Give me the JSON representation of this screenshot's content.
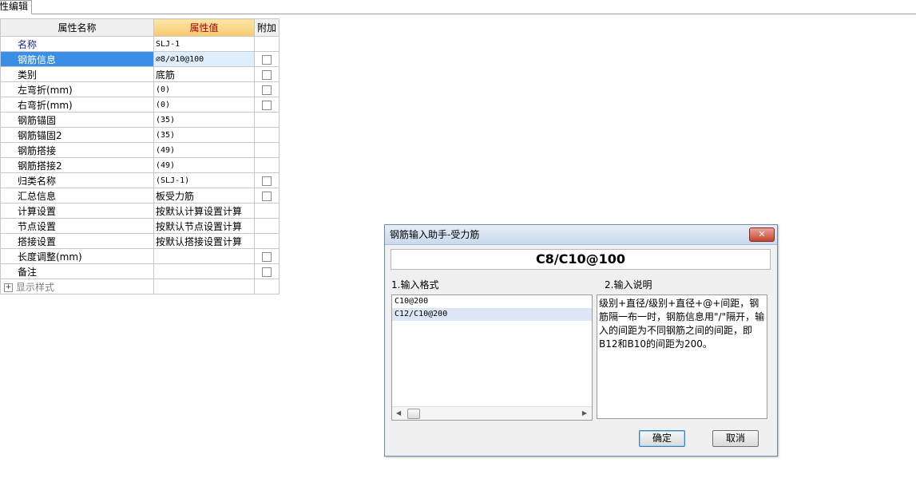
{
  "tab": {
    "label": "性编辑"
  },
  "grid": {
    "headers": {
      "name": "属性名称",
      "value": "属性值",
      "extra": "附加"
    },
    "rows": [
      {
        "name": "名称",
        "value": "SLJ-1"
      },
      {
        "name": "钢筋信息",
        "value": "⌀8/⌀10@100",
        "selected": true
      },
      {
        "name": "类别",
        "value": "底筋"
      },
      {
        "name": "左弯折(mm)",
        "value": "(0)"
      },
      {
        "name": "右弯折(mm)",
        "value": "(0)"
      },
      {
        "name": "钢筋锚固",
        "value": "(35)"
      },
      {
        "name": "钢筋锚固2",
        "value": "(35)"
      },
      {
        "name": "钢筋搭接",
        "value": "(49)"
      },
      {
        "name": "钢筋搭接2",
        "value": "(49)"
      },
      {
        "name": "归类名称",
        "value": "(SLJ-1)"
      },
      {
        "name": "汇总信息",
        "value": "板受力筋"
      },
      {
        "name": "计算设置",
        "value": "按默认计算设置计算"
      },
      {
        "name": "节点设置",
        "value": "按默认节点设置计算"
      },
      {
        "name": "搭接设置",
        "value": "按默认搭接设置计算"
      },
      {
        "name": "长度调整(mm)",
        "value": ""
      },
      {
        "name": "备注",
        "value": ""
      }
    ],
    "expand_row": "显示样式"
  },
  "dialog": {
    "title": "钢筋输入助手-受力筋",
    "close_label": "✕",
    "display_value": "C8/C10@100",
    "format_label": "1.输入格式",
    "desc_label": "2.输入说明",
    "formats": [
      "C10@200",
      "C12/C10@200"
    ],
    "description": "级别+直径/级别+直径+@+间距，钢筋隔一布一时，钢筋信息用\"/\"隔开，输入的间距为不同钢筋之间的间距，即B12和B10的间距为200。",
    "ok_label": "确定",
    "cancel_label": "取消"
  }
}
